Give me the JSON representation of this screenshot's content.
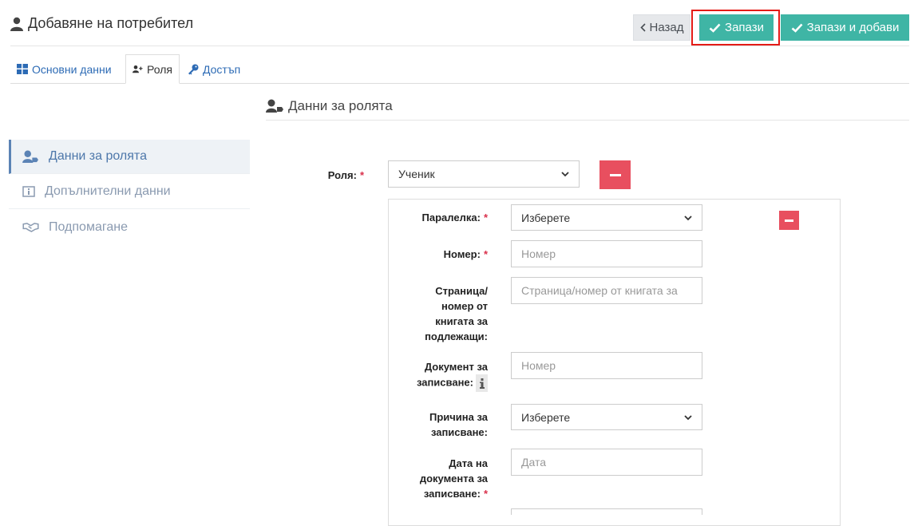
{
  "header": {
    "title": "Добавяне на потребител",
    "back_label": "Назад",
    "save_label": "Запази",
    "save_add_label": "Запази и добави"
  },
  "tabs": [
    {
      "label": "Основни данни",
      "icon": "grid-icon"
    },
    {
      "label": "Роля",
      "icon": "user-plus-icon"
    },
    {
      "label": "Достъп",
      "icon": "key-icon"
    }
  ],
  "section": {
    "title": "Данни за ролята"
  },
  "sidebar": {
    "items": [
      {
        "label": "Данни за ролята",
        "icon": "user-tag-icon",
        "active": true
      },
      {
        "label": "Допълнителни данни",
        "icon": "info-icon",
        "active": false
      },
      {
        "label": "Подпомагане",
        "icon": "handshake-icon",
        "active": false
      }
    ]
  },
  "form": {
    "role": {
      "label": "Роля:",
      "value": "Ученик"
    },
    "class": {
      "label": "Паралелка:",
      "value": "Изберете"
    },
    "number": {
      "label": "Номер:",
      "placeholder": "Номер"
    },
    "page": {
      "label_lines": [
        "Страница/",
        "номер от",
        "книгата за",
        "подлежащи:"
      ],
      "placeholder": "Страница/номер от книгата за"
    },
    "doc": {
      "label_lines": [
        "Документ за",
        "записване:"
      ],
      "placeholder": "Номер"
    },
    "reason": {
      "label_lines": [
        "Причина за",
        "записване:"
      ],
      "value": "Изберете"
    },
    "date": {
      "label_lines": [
        "Дата на",
        "документа за",
        "записване:"
      ],
      "placeholder": "Дата"
    }
  },
  "colors": {
    "accent": "#3fb5a5",
    "danger": "#e84f5f",
    "highlight": "#e41b17",
    "link": "#2d6bb5"
  }
}
